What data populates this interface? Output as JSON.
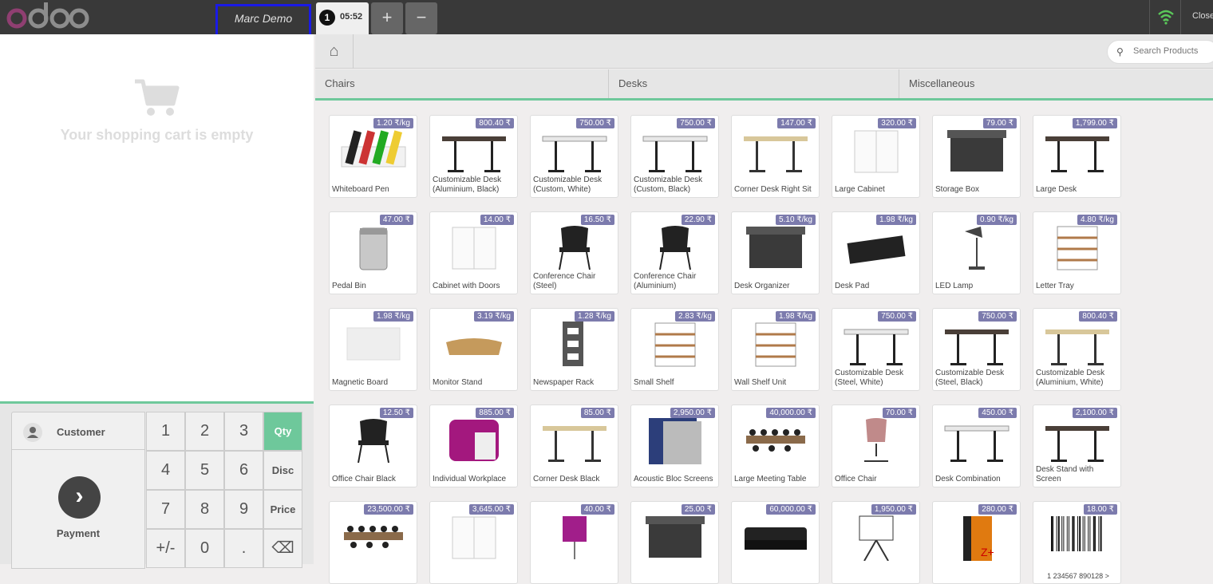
{
  "topbar": {
    "logo": "odoo",
    "cashier": "Marc Demo",
    "order_number": "1",
    "order_time": "05:52",
    "add_label": "+",
    "remove_label": "−",
    "close_label": "Close"
  },
  "cart": {
    "empty_label": "Your shopping cart is empty"
  },
  "pad": {
    "customer_label": "Customer",
    "payment_label": "Payment",
    "keys": [
      "1",
      "2",
      "3",
      "4",
      "5",
      "6",
      "7",
      "8",
      "9",
      "+/-",
      "0",
      "."
    ],
    "modes": [
      "Qty",
      "Disc",
      "Price"
    ],
    "backspace": "⌫"
  },
  "search": {
    "placeholder": "Search Products"
  },
  "categories": [
    "Chairs",
    "Desks",
    "Miscellaneous"
  ],
  "products": [
    {
      "name": "Whiteboard Pen",
      "price": "1.20 ₹/kg",
      "icon": "pens"
    },
    {
      "name": "Customizable Desk (Aluminium, Black)",
      "price": "800.40 ₹",
      "icon": "desk-dark"
    },
    {
      "name": "Customizable Desk (Custom, White)",
      "price": "750.00 ₹",
      "icon": "desk-white"
    },
    {
      "name": "Customizable Desk (Custom, Black)",
      "price": "750.00 ₹",
      "icon": "desk-white"
    },
    {
      "name": "Corner Desk Right Sit",
      "price": "147.00 ₹",
      "icon": "desk-wood"
    },
    {
      "name": "Large Cabinet",
      "price": "320.00 ₹",
      "icon": "cabinet"
    },
    {
      "name": "Storage Box",
      "price": "79.00 ₹",
      "icon": "box"
    },
    {
      "name": "Large Desk",
      "price": "1,799.00 ₹",
      "icon": "desk-dark"
    },
    {
      "name": "Pedal Bin",
      "price": "47.00 ₹",
      "icon": "bin"
    },
    {
      "name": "Cabinet with Doors",
      "price": "14.00 ₹",
      "icon": "cabinet"
    },
    {
      "name": "Conference Chair (Steel)",
      "price": "16.50 ₹",
      "icon": "chair"
    },
    {
      "name": "Conference Chair (Aluminium)",
      "price": "22.90 ₹",
      "icon": "chair"
    },
    {
      "name": "Desk Organizer",
      "price": "5.10 ₹/kg",
      "icon": "box"
    },
    {
      "name": "Desk Pad",
      "price": "1.98 ₹/kg",
      "icon": "pad"
    },
    {
      "name": "LED Lamp",
      "price": "0.90 ₹/kg",
      "icon": "lamp"
    },
    {
      "name": "Letter Tray",
      "price": "4.80 ₹/kg",
      "icon": "shelf"
    },
    {
      "name": "Magnetic Board",
      "price": "1.98 ₹/kg",
      "icon": "board"
    },
    {
      "name": "Monitor Stand",
      "price": "3.19 ₹/kg",
      "icon": "stand"
    },
    {
      "name": "Newspaper Rack",
      "price": "1.28 ₹/kg",
      "icon": "rack"
    },
    {
      "name": "Small Shelf",
      "price": "2.83 ₹/kg",
      "icon": "shelf"
    },
    {
      "name": "Wall Shelf Unit",
      "price": "1.98 ₹/kg",
      "icon": "shelf"
    },
    {
      "name": "Customizable Desk (Steel, White)",
      "price": "750.00 ₹",
      "icon": "desk-white"
    },
    {
      "name": "Customizable Desk (Steel, Black)",
      "price": "750.00 ₹",
      "icon": "desk-dark"
    },
    {
      "name": "Customizable Desk (Aluminium, White)",
      "price": "800.40 ₹",
      "icon": "desk-wood"
    },
    {
      "name": "Office Chair Black",
      "price": "12.50 ₹",
      "icon": "chair"
    },
    {
      "name": "Individual Workplace",
      "price": "885.00 ₹",
      "icon": "pod"
    },
    {
      "name": "Corner Desk Black",
      "price": "85.00 ₹",
      "icon": "desk-wood"
    },
    {
      "name": "Acoustic Bloc Screens",
      "price": "2,950.00 ₹",
      "icon": "screen"
    },
    {
      "name": "Large Meeting Table",
      "price": "40,000.00 ₹",
      "icon": "table"
    },
    {
      "name": "Office Chair",
      "price": "70.00 ₹",
      "icon": "chair-pink"
    },
    {
      "name": "Desk Combination",
      "price": "450.00 ₹",
      "icon": "desk-white"
    },
    {
      "name": "Desk Stand with Screen",
      "price": "2,100.00 ₹",
      "icon": "desk-dark"
    },
    {
      "name": "",
      "price": "23,500.00 ₹",
      "icon": "table"
    },
    {
      "name": "",
      "price": "3,645.00 ₹",
      "icon": "cabinet"
    },
    {
      "name": "",
      "price": "40.00 ₹",
      "icon": "lamp-pink"
    },
    {
      "name": "",
      "price": "25.00 ₹",
      "icon": "box"
    },
    {
      "name": "",
      "price": "60,000.00 ₹",
      "icon": "sofa"
    },
    {
      "name": "",
      "price": "1,950.00 ₹",
      "icon": "easel"
    },
    {
      "name": "",
      "price": "280.00 ₹",
      "icon": "software"
    },
    {
      "name": "",
      "price": "18.00 ₹",
      "icon": "barcode"
    }
  ],
  "barcode_text": "1 234567 890128 >",
  "colors": {
    "accent": "#6ec89b",
    "price_badge": "#7c7bad",
    "topbar": "#393939",
    "cashier_highlight": "#1a1ae6"
  }
}
